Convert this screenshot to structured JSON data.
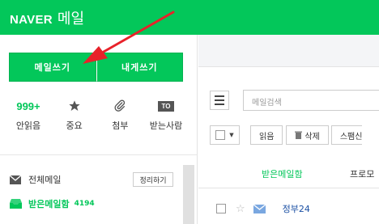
{
  "header": {
    "brand": "NAVER",
    "service": "메일",
    "bg_color": "#03c75a"
  },
  "compose": {
    "write_label": "메일쓰기",
    "self_label": "내게쓰기"
  },
  "quick": {
    "unread_count": "999+",
    "unread_label": "안읽음",
    "star_label": "중요",
    "attach_label": "첨부",
    "to_icon_text": "TO",
    "to_label": "받는사람"
  },
  "folders": {
    "all_label": "전체메일",
    "cleanup_label": "정리하기",
    "inbox_label": "받은메일함",
    "inbox_count": "4194"
  },
  "search": {
    "placeholder": "메일검색"
  },
  "toolbar": {
    "read_label": "읽음",
    "delete_label": "삭제",
    "spam_label": "스팸신"
  },
  "tabs": {
    "inbox": "받은메일함",
    "promo": "프로모"
  },
  "mail_rows": [
    {
      "sender": "정부24"
    }
  ],
  "accent_color": "#03c75a",
  "annotation_color": "#e8222a"
}
